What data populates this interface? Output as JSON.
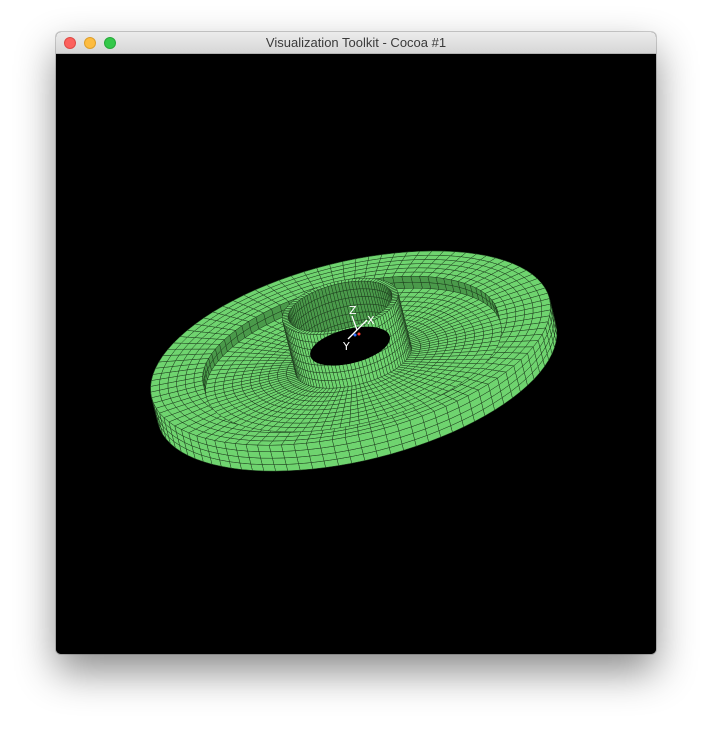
{
  "window": {
    "title": "Visualization Toolkit - Cocoa #1"
  },
  "viewport": {
    "background": "#000000",
    "mesh_fill": "#6fd46f",
    "mesh_dark": "#4a9a4a",
    "mesh_line": "#1d3b1d"
  },
  "axes": {
    "x_label": "X",
    "y_label": "Y",
    "z_label": "Z"
  },
  "colors": {
    "close": "#fc615d",
    "minimize": "#fdbc40",
    "zoom": "#34c84a"
  }
}
